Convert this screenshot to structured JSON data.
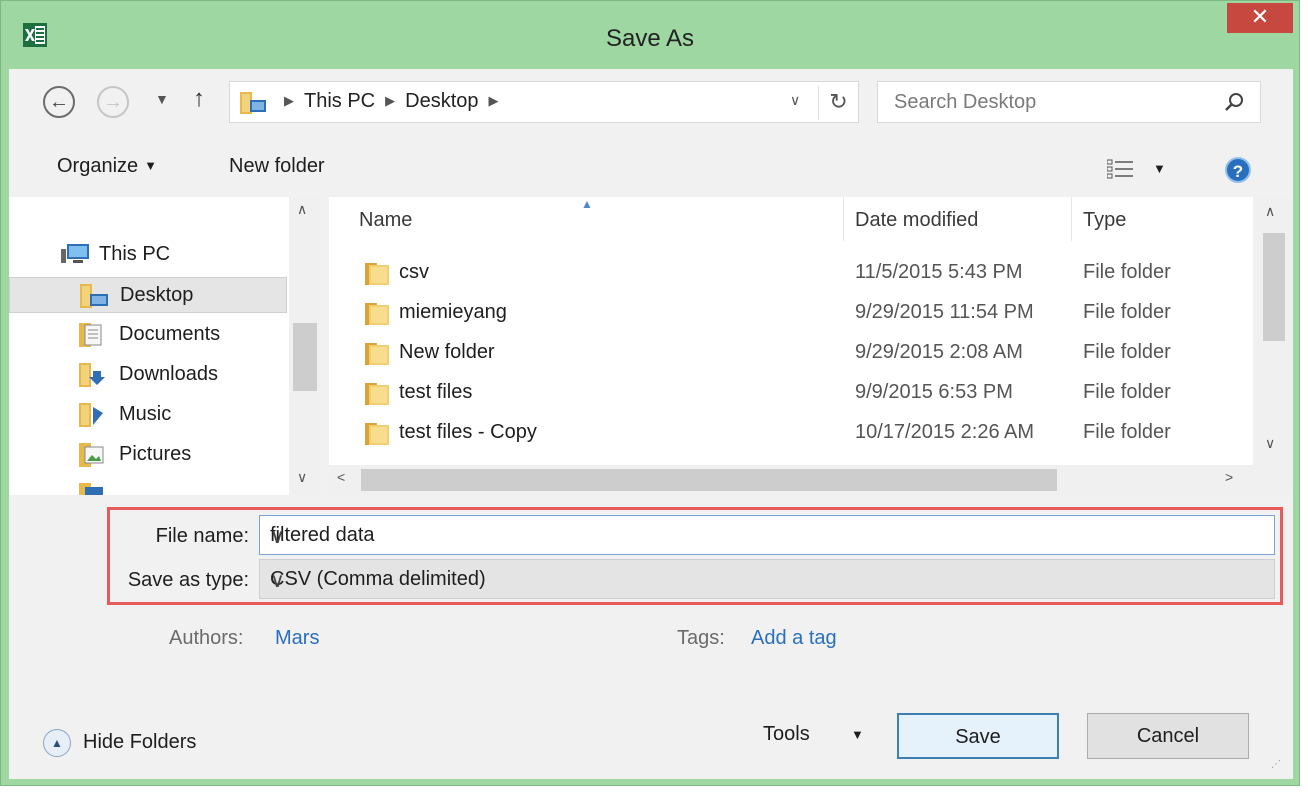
{
  "window": {
    "title": "Save As",
    "close_glyph": "✕",
    "app_icon": "excel-icon",
    "accent_color": "#9fd7a2",
    "close_color": "#c7483f"
  },
  "address_bar": {
    "path": [
      "This PC",
      "Desktop"
    ],
    "search_placeholder": "Search Desktop"
  },
  "toolbar": {
    "organize_label": "Organize",
    "new_folder_label": "New folder",
    "help_glyph": "?"
  },
  "nav_pane": {
    "items": [
      {
        "label": "This PC",
        "icon": "computer-icon"
      },
      {
        "label": "Desktop",
        "icon": "desktop-folder-icon",
        "selected": true
      },
      {
        "label": "Documents",
        "icon": "documents-icon"
      },
      {
        "label": "Downloads",
        "icon": "downloads-icon"
      },
      {
        "label": "Music",
        "icon": "music-icon"
      },
      {
        "label": "Pictures",
        "icon": "pictures-icon"
      }
    ]
  },
  "file_list": {
    "columns": [
      "Name",
      "Date modified",
      "Type"
    ],
    "sort_column": "Name",
    "rows": [
      {
        "name": "csv",
        "date": "11/5/2015 5:43 PM",
        "type": "File folder"
      },
      {
        "name": "miemieyang",
        "date": "9/29/2015 11:54 PM",
        "type": "File folder"
      },
      {
        "name": "New folder",
        "date": "9/29/2015 2:08 AM",
        "type": "File folder"
      },
      {
        "name": "test files",
        "date": "9/9/2015 6:53 PM",
        "type": "File folder"
      },
      {
        "name": "test files - Copy",
        "date": "10/17/2015 2:26 AM",
        "type": "File folder"
      }
    ]
  },
  "form": {
    "file_name_label": "File name:",
    "file_name_value": "filtered data",
    "save_type_label": "Save as type:",
    "save_type_value": "CSV (Comma delimited)",
    "highlight_color": "#e55a5a"
  },
  "meta": {
    "authors_label": "Authors:",
    "authors_value": "Mars",
    "tags_label": "Tags:",
    "tags_value": "Add a tag"
  },
  "footer": {
    "hide_folders_label": "Hide Folders",
    "tools_label": "Tools",
    "save_label": "Save",
    "cancel_label": "Cancel"
  }
}
